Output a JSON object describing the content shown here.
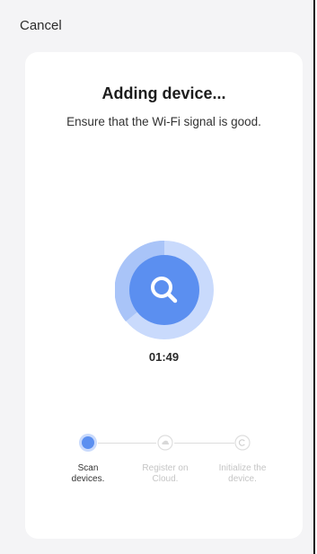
{
  "header": {
    "cancel_label": "Cancel"
  },
  "main": {
    "title": "Adding device...",
    "subtitle": "Ensure that the Wi-Fi signal is good.",
    "scan_icon": "search-icon",
    "timer": "01:49"
  },
  "steps": [
    {
      "line1": "Scan",
      "line2": "devices.",
      "state": "active",
      "icon": "radio-dot-icon"
    },
    {
      "line1": "Register on",
      "line2": "Cloud.",
      "state": "pending",
      "icon": "cloud-icon"
    },
    {
      "line1": "Initialize the",
      "line2": "device.",
      "state": "pending",
      "icon": "copyright-like-icon"
    }
  ],
  "colors": {
    "accent": "#5b8ff0",
    "accent_light": "#c9dafc",
    "background": "#f4f4f6",
    "card": "#ffffff",
    "inactive": "#c5c5c5"
  }
}
